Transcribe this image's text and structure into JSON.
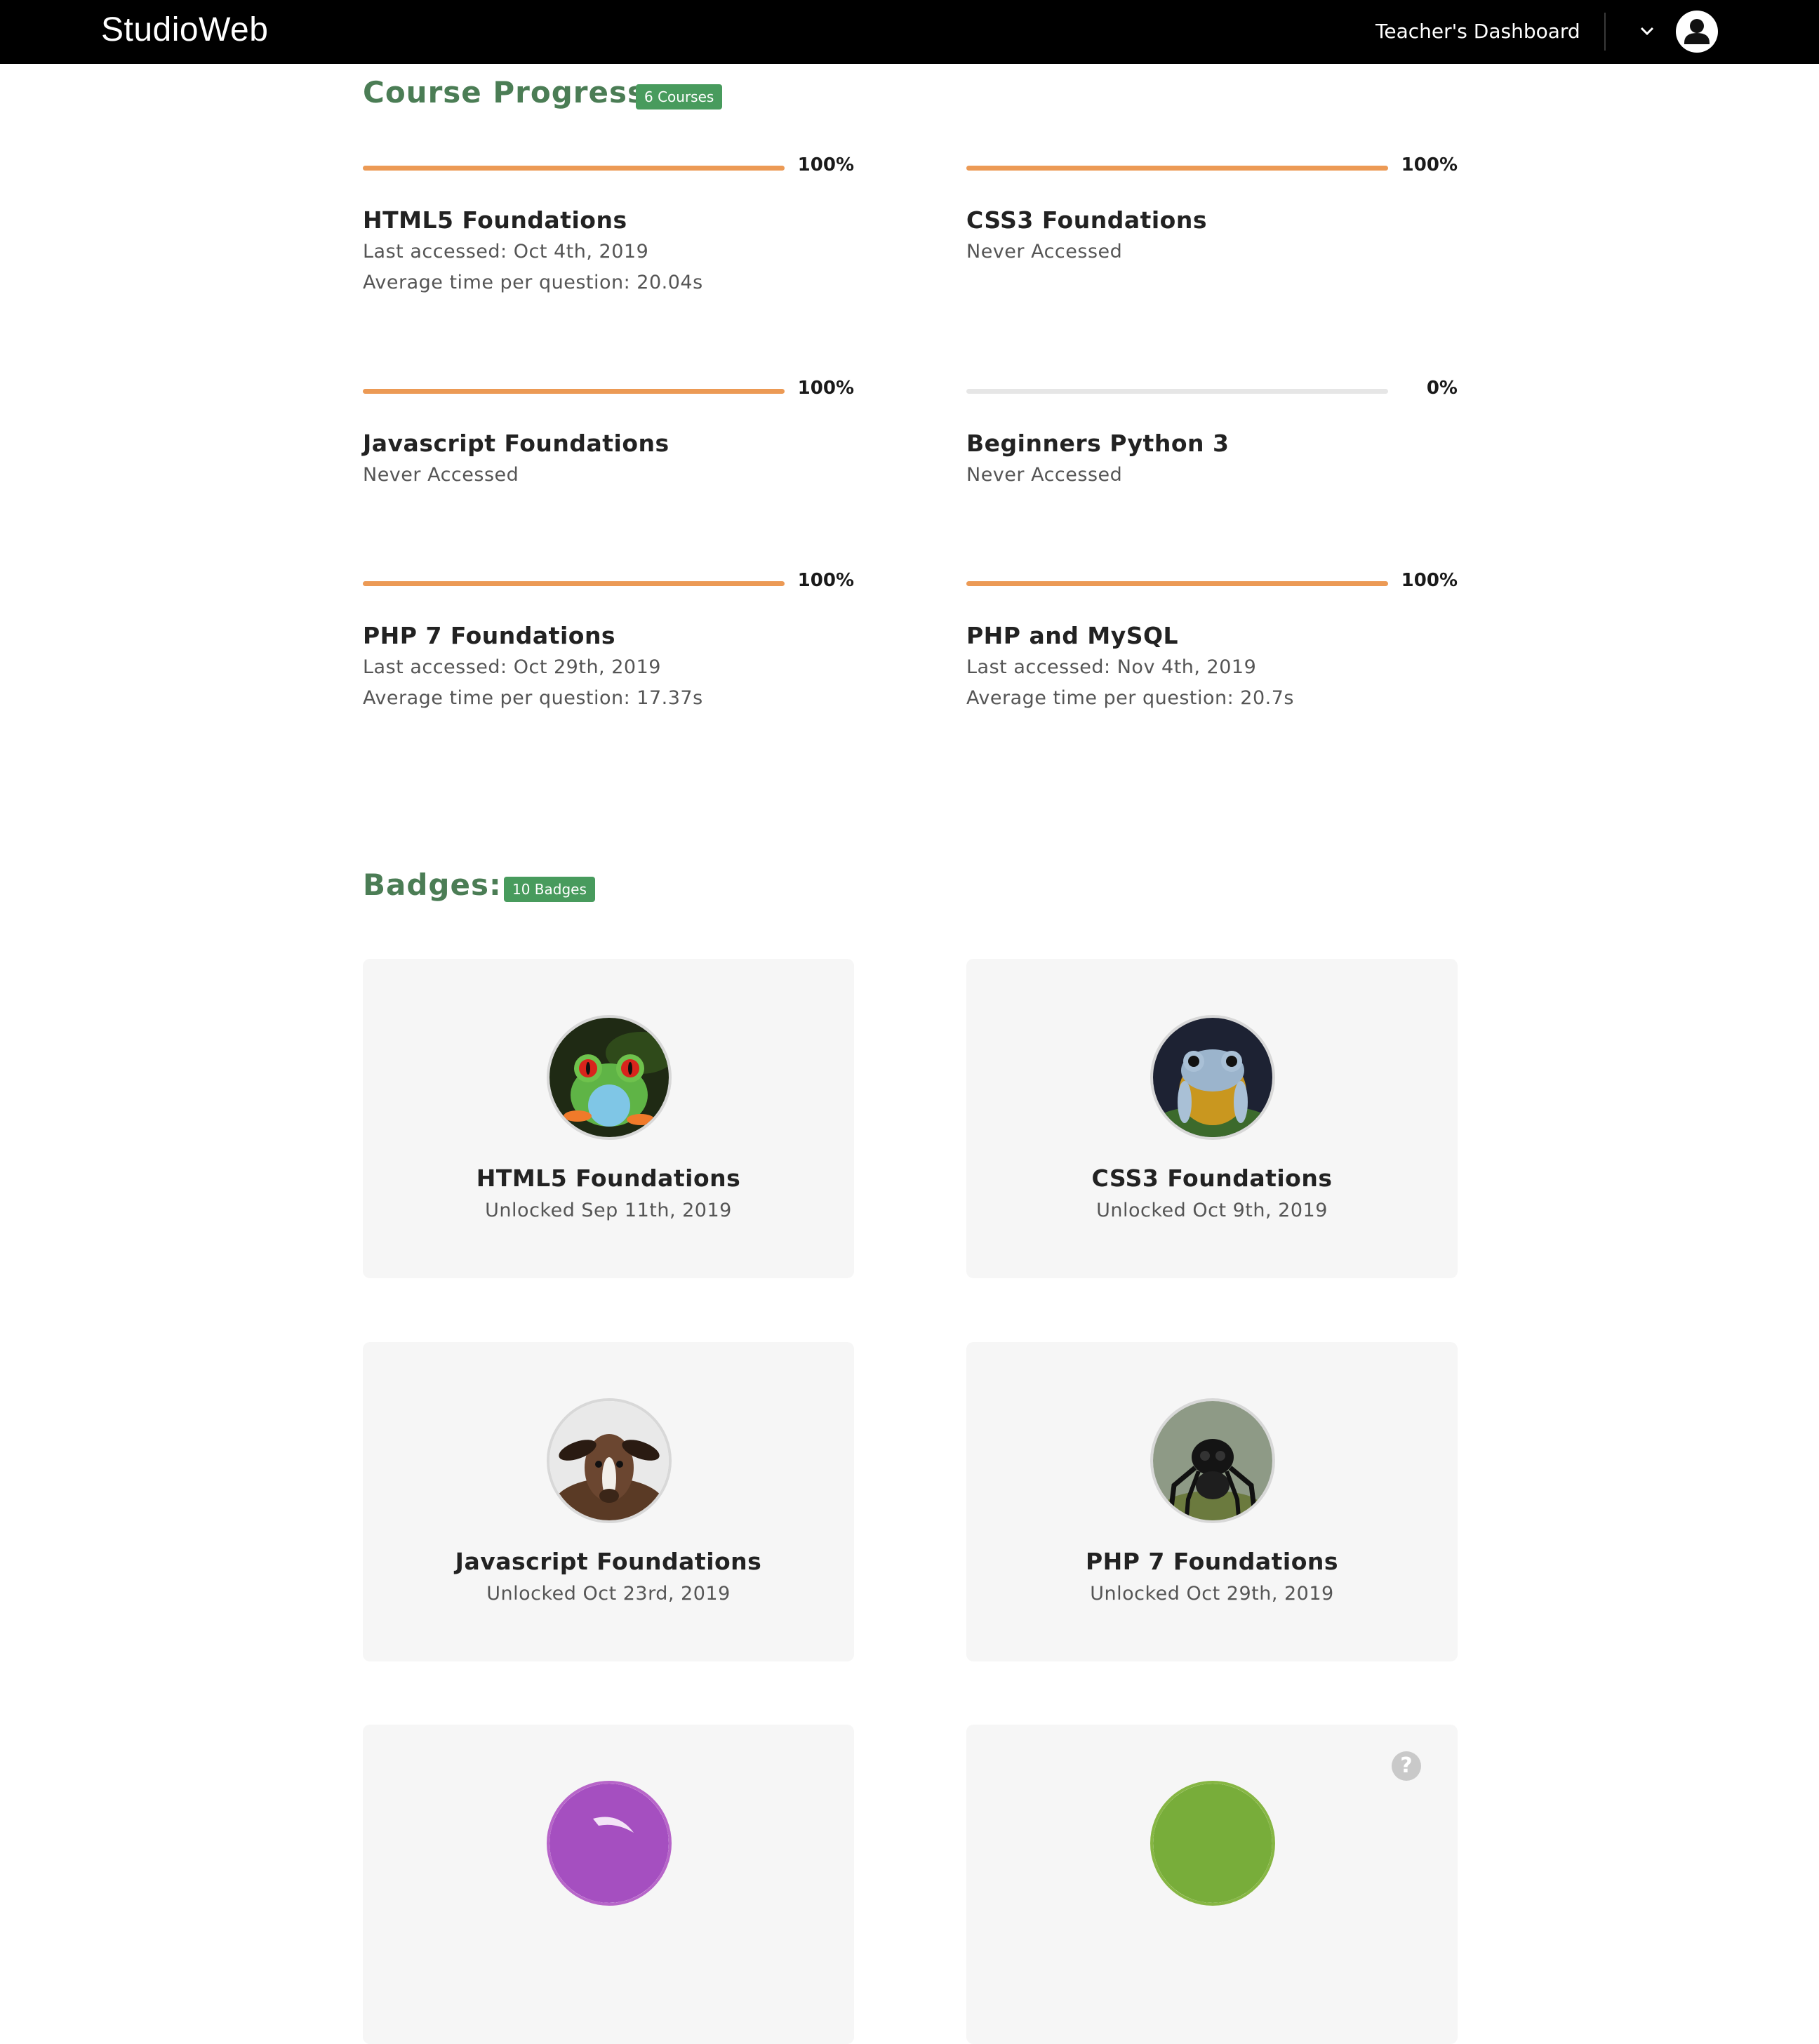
{
  "header": {
    "brand_light": "Studio",
    "brand_bold": "Web",
    "nav_link": "Teacher's Dashboard",
    "caret_icon": "chevron-down-icon",
    "avatar_icon": "user-avatar-icon"
  },
  "course_progress": {
    "title": "Course Progress:",
    "count_badge": "6 Courses",
    "courses": [
      {
        "name": "HTML5 Foundations",
        "percent_label": "100%",
        "progress": 1.0,
        "line1": "Last accessed: Oct 4th, 2019",
        "line2": "Average time per question: 20.04s"
      },
      {
        "name": "CSS3 Foundations",
        "percent_label": "100%",
        "progress": 1.0,
        "line1": "Never Accessed",
        "line2": ""
      },
      {
        "name": "Javascript Foundations",
        "percent_label": "100%",
        "progress": 1.0,
        "line1": "Never Accessed",
        "line2": ""
      },
      {
        "name": "Beginners Python 3",
        "percent_label": "0%",
        "progress": 0.0,
        "line1": "Never Accessed",
        "line2": ""
      },
      {
        "name": "PHP 7 Foundations",
        "percent_label": "100%",
        "progress": 1.0,
        "line1": "Last accessed: Oct 29th, 2019",
        "line2": "Average time per question: 17.37s"
      },
      {
        "name": "PHP and MySQL",
        "percent_label": "100%",
        "progress": 1.0,
        "line1": "Last accessed: Nov 4th, 2019",
        "line2": "Average time per question: 20.7s"
      }
    ]
  },
  "badges": {
    "title": "Badges:",
    "count_badge": "10 Badges",
    "items": [
      {
        "name": "HTML5 Foundations",
        "unlocked": "Unlocked Sep 11th, 2019",
        "image": "red-eyed-tree-frog"
      },
      {
        "name": "CSS3 Foundations",
        "unlocked": "Unlocked Oct 9th, 2019",
        "image": "blue-yellow-frog"
      },
      {
        "name": "Javascript Foundations",
        "unlocked": "Unlocked Oct 23rd, 2019",
        "image": "brown-goat"
      },
      {
        "name": "PHP 7 Foundations",
        "unlocked": "Unlocked Oct 29th, 2019",
        "image": "jumping-spider"
      },
      {
        "name": "",
        "unlocked": "",
        "image": "purple-badge"
      },
      {
        "name": "",
        "unlocked": "",
        "image": "green-badge",
        "help_icon": "question-mark-icon",
        "help_label": "?"
      }
    ]
  },
  "colors": {
    "accent_green": "#4b7d55",
    "pill_green": "#489b5d",
    "progress_orange": "#ec9a55",
    "track_grey": "#e6e6e6"
  }
}
